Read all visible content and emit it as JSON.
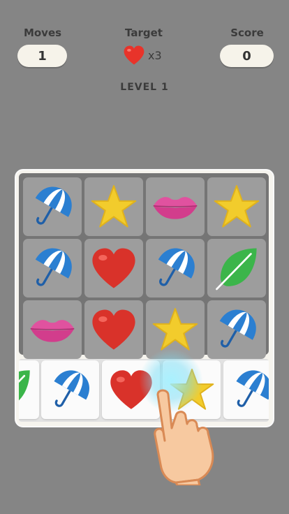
{
  "hud": {
    "moves_label": "Moves",
    "moves_value": "1",
    "target_label": "Target",
    "target_icon": "heart-icon",
    "target_count": "x3",
    "score_label": "Score",
    "score_value": "0"
  },
  "level_label": "LEVEL 1",
  "board": {
    "rows": [
      [
        "umbrella",
        "star",
        "lips",
        "star"
      ],
      [
        "umbrella",
        "heart",
        "umbrella",
        "leaf"
      ],
      [
        "lips",
        "heart",
        "star",
        "umbrella"
      ]
    ],
    "active_row": [
      "leaf",
      "umbrella",
      "heart",
      "star",
      "umbrella"
    ]
  },
  "tutorial": {
    "gesture": "hand-pointer-icon",
    "action": "swipe row"
  },
  "colors": {
    "background": "#858585",
    "heart": "#d9322a",
    "star": "#f2cc2c",
    "leaf": "#3bb54a",
    "umbrella": "#2b7fd1",
    "lips": "#e0529f"
  }
}
